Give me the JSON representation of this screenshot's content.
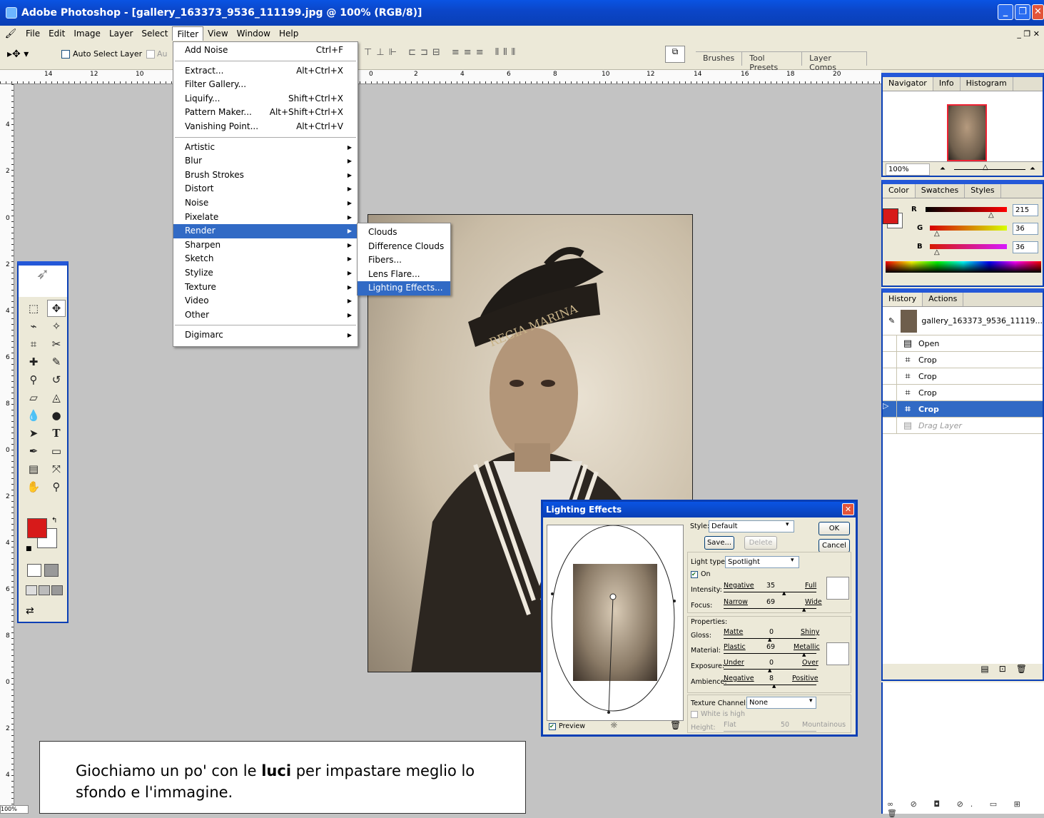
{
  "window": {
    "title": "Adobe Photoshop - [gallery_163373_9536_111199.jpg @ 100% (RGB/8)]"
  },
  "menubar": [
    "File",
    "Edit",
    "Image",
    "Layer",
    "Select",
    "Filter",
    "View",
    "Window",
    "Help"
  ],
  "options": {
    "auto_select": "Auto Select Layer",
    "auto_truncated": "Au"
  },
  "palette_well": [
    "Brushes",
    "Tool Presets",
    "Layer Comps"
  ],
  "filter_menu": [
    {
      "label": "Add Noise",
      "sc": "Ctrl+F"
    },
    {
      "label": "Extract...",
      "sc": "Alt+Ctrl+X"
    },
    {
      "label": "Filter Gallery..."
    },
    {
      "label": "Liquify...",
      "sc": "Shift+Ctrl+X"
    },
    {
      "label": "Pattern Maker...",
      "sc": "Alt+Shift+Ctrl+X"
    },
    {
      "label": "Vanishing Point...",
      "sc": "Alt+Ctrl+V"
    },
    {
      "label": "Artistic"
    },
    {
      "label": "Blur"
    },
    {
      "label": "Brush Strokes"
    },
    {
      "label": "Distort"
    },
    {
      "label": "Noise"
    },
    {
      "label": "Pixelate"
    },
    {
      "label": "Render"
    },
    {
      "label": "Sharpen"
    },
    {
      "label": "Sketch"
    },
    {
      "label": "Stylize"
    },
    {
      "label": "Texture"
    },
    {
      "label": "Video"
    },
    {
      "label": "Other"
    },
    {
      "label": "Digimarc"
    }
  ],
  "render_menu": [
    "Clouds",
    "Difference Clouds",
    "Fibers...",
    "Lens Flare...",
    "Lighting Effects..."
  ],
  "ruler": {
    "h": [
      "14",
      "12",
      "10",
      "0",
      "2",
      "4",
      "6",
      "8",
      "10",
      "12",
      "14",
      "16",
      "18",
      "20"
    ],
    "v": [
      "4",
      "2",
      "0",
      "2",
      "4",
      "6",
      "8",
      "0",
      "2",
      "4",
      "6",
      "8",
      "0",
      "2",
      "4",
      "6",
      "8",
      "0"
    ]
  },
  "photo_cap_text": "REGIA MARINA",
  "navigator": {
    "tabs": [
      "Navigator",
      "Info",
      "Histogram"
    ],
    "zoom": "100%"
  },
  "color": {
    "tabs": [
      "Color",
      "Swatches",
      "Styles"
    ],
    "channels": [
      {
        "name": "R",
        "value": "215"
      },
      {
        "name": "G",
        "value": "36"
      },
      {
        "name": "B",
        "value": "36"
      }
    ],
    "fg": "#d71a1a"
  },
  "history": {
    "tabs": [
      "History",
      "Actions"
    ],
    "snapshot": "gallery_163373_9536_11119...",
    "items": [
      "Open",
      "Crop",
      "Crop",
      "Crop",
      "Crop",
      "Drag Layer"
    ]
  },
  "lighting": {
    "title": "Lighting Effects",
    "style_label": "Style:",
    "style_value": "Default",
    "save": "Save...",
    "delete": "Delete",
    "ok": "OK",
    "cancel": "Cancel",
    "light_type_label": "Light type:",
    "light_type_value": "Spotlight",
    "on": "On",
    "intensity": {
      "label": "Intensity:",
      "lo": "Negative",
      "value": "35",
      "hi": "Full"
    },
    "focus": {
      "label": "Focus:",
      "lo": "Narrow",
      "value": "69",
      "hi": "Wide"
    },
    "properties": "Properties:",
    "gloss": {
      "label": "Gloss:",
      "lo": "Matte",
      "value": "0",
      "hi": "Shiny"
    },
    "material": {
      "label": "Material:",
      "lo": "Plastic",
      "value": "69",
      "hi": "Metallic"
    },
    "exposure": {
      "label": "Exposure:",
      "lo": "Under",
      "value": "0",
      "hi": "Over"
    },
    "ambience": {
      "label": "Ambience:",
      "lo": "Negative",
      "value": "8",
      "hi": "Positive"
    },
    "texture_label": "Texture Channel:",
    "texture_value": "None",
    "white_high": "White is high",
    "height": {
      "label": "Height:",
      "lo": "Flat",
      "value": "50",
      "hi": "Mountainous"
    },
    "preview": "Preview"
  },
  "status_zoom": "100%",
  "caption": {
    "before": "Giochiamo un po' con le ",
    "bold": "luci",
    "after": " per impastare meglio lo sfondo e l'immagine."
  }
}
